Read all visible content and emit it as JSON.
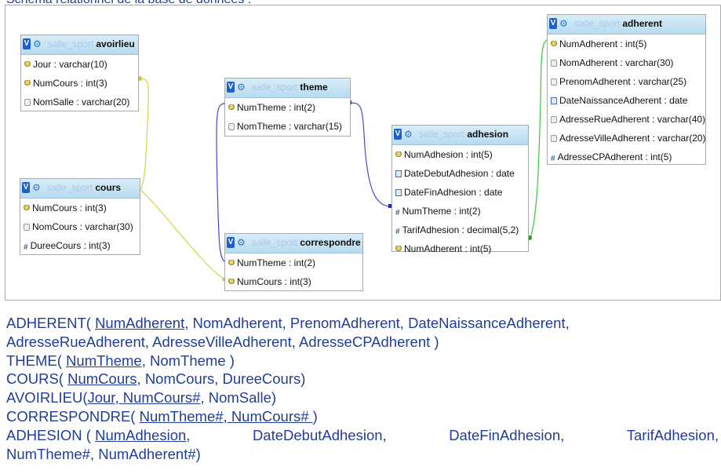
{
  "caption": "Schéma relationnel de la base de données :",
  "icons": {
    "view": "V",
    "settings": "gear-icon",
    "primary_key": "key-icon",
    "text_column": "column-icon",
    "date_column": "date-icon",
    "numeric_column": "hash-icon"
  },
  "tables": {
    "avoirlieu": {
      "schema": "salle_sport",
      "name": "avoirlieu",
      "rows": [
        "Jour : varchar(10)",
        "NumCours : int(3)",
        "NomSalle : varchar(20)"
      ]
    },
    "cours": {
      "schema": "salle_sport",
      "name": "cours",
      "rows": [
        "NumCours : int(3)",
        "NomCours : varchar(30)",
        "DureeCours : int(3)"
      ]
    },
    "theme": {
      "schema": "salle_sport",
      "name": "theme",
      "rows": [
        "NumTheme : int(2)",
        "NomTheme : varchar(15)"
      ]
    },
    "correspondre": {
      "schema": "salle_sport",
      "name": "correspondre",
      "rows": [
        "NumTheme : int(2)",
        "NumCours : int(3)"
      ]
    },
    "adhesion": {
      "schema": "salle_sport",
      "name": "adhesion",
      "rows": [
        "NumAdhesion : int(5)",
        "DateDebutAdhesion : date",
        "DateFinAdhesion : date",
        "NumTheme : int(2)",
        "TarifAdhesion : decimal(5,2)",
        "NumAdherent : int(5)"
      ]
    },
    "adherent": {
      "schema": "salle_sport",
      "name": "adherent",
      "rows": [
        "NumAdherent : int(5)",
        "NomAdherent : varchar(30)",
        "PrenomAdherent : varchar(25)",
        "DateNaissanceAdherent : date",
        "AdresseRueAdherent : varchar(40)",
        "AdresseVilleAdherent : varchar(20)",
        "AdresseCPAdherent : int(5)"
      ]
    }
  },
  "relational": {
    "adherent": {
      "head": "ADHERENT( ",
      "key": "NumAdherent",
      "rest1": ", NomAdherent, PrenomAdherent, DateNaissanceAdherent,",
      "line2": "AdresseRueAdherent, AdresseVilleAdherent, AdresseCPAdherent )"
    },
    "theme": {
      "head": "THEME( ",
      "key": "NumTheme",
      "rest": ", NomTheme )"
    },
    "cours": {
      "head": "COURS( ",
      "key": "NumCours",
      "rest": ", NomCours, DureeCours)"
    },
    "avoirlieu": {
      "head": "AVOIRLIEU(",
      "key": "Jour, NumCours#",
      "rest": ", NomSalle)"
    },
    "correspondre": {
      "head": "CORRESPONDRE( ",
      "key": "NumTheme#, NumCours# ",
      "rest": ")"
    },
    "adhesion": {
      "head": "ADHESION ( ",
      "key": "NumAdhesion",
      "rest1": ",",
      "w2": "DateDebutAdhesion,",
      "w3": "DateFinAdhesion,",
      "w4": "TarifAdhesion,",
      "line2": "NumTheme#, NumAdherent#)"
    }
  }
}
